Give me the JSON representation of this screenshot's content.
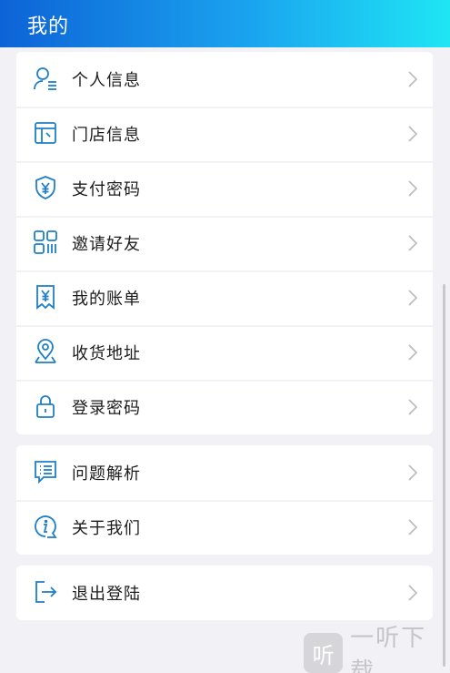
{
  "header": {
    "title": "我的"
  },
  "group1": {
    "items": [
      {
        "label": "个人信息",
        "icon": "user-info-icon"
      },
      {
        "label": "门店信息",
        "icon": "store-icon"
      },
      {
        "label": "支付密码",
        "icon": "shield-yen-icon"
      },
      {
        "label": "邀请好友",
        "icon": "qr-code-icon"
      },
      {
        "label": "我的账单",
        "icon": "bill-icon"
      },
      {
        "label": "收货地址",
        "icon": "location-pin-icon"
      },
      {
        "label": "登录密码",
        "icon": "lock-icon"
      }
    ]
  },
  "group2": {
    "items": [
      {
        "label": "问题解析",
        "icon": "faq-list-icon"
      },
      {
        "label": "关于我们",
        "icon": "info-icon"
      }
    ]
  },
  "group3": {
    "items": [
      {
        "label": "退出登陆",
        "icon": "logout-icon"
      }
    ]
  },
  "watermark": {
    "logo_char": "听",
    "text": "一听下载"
  },
  "colors": {
    "accent": "#1f7fc6",
    "header_start": "#0d63d6",
    "header_end": "#1fe6f4",
    "chevron": "#bdbdc2"
  }
}
